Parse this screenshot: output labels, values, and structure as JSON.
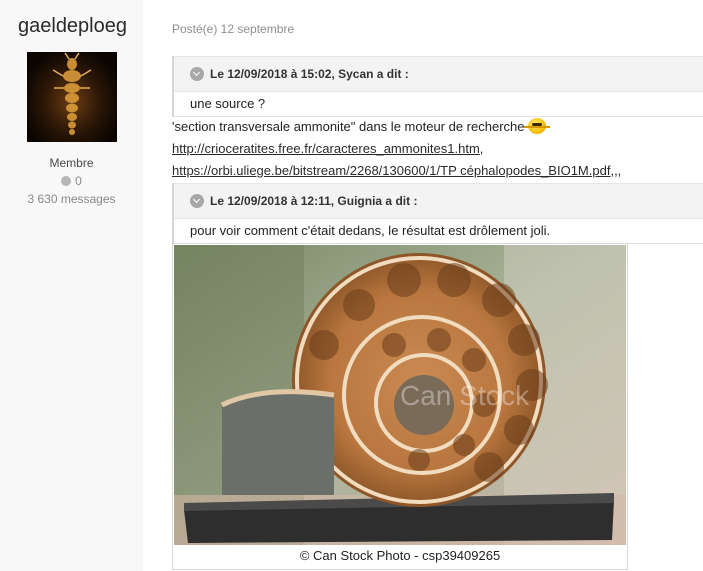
{
  "author": {
    "username": "gaeldeploeg",
    "rank": "Membre",
    "reputation": "0",
    "message_count": "3 630 messages"
  },
  "post": {
    "posted": "Posté(e) 12 septembre",
    "quote1": {
      "header": "Le 12/09/2018 à 15:02, Sycan a dit :",
      "body": "une source ?"
    },
    "text_line": "'section transversale ammonite\" dans le moteur de recherche",
    "link1": "http://crioceratites.free.fr/caracteres_ammonites1.htm",
    "link1_suffix": ",",
    "link2": "https://orbi.uliege.be/bitstream/2268/130600/1/TP céphalopodes_BIO1M.pdf",
    "link2_suffix": ",,,",
    "quote2": {
      "header": "Le 12/09/2018 à 12:11, Guignia a dit :",
      "body": "pour voir comment c'était dedans, le résultat est drôlement joli."
    },
    "image_caption": "© Can Stock Photo - csp39409265",
    "watermark": "Can Stock"
  },
  "colors": {
    "link": "#2a2a2a",
    "sidebar_bg": "#f8f8f8"
  }
}
